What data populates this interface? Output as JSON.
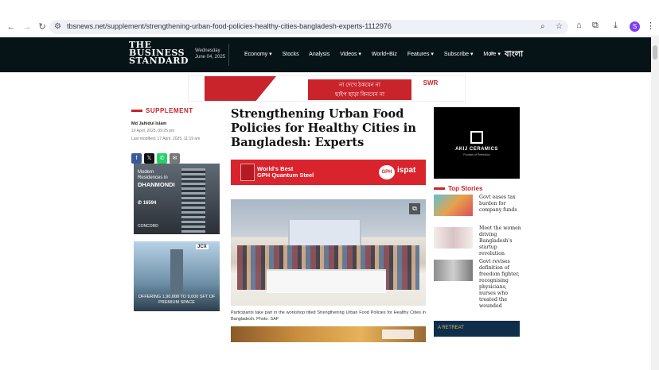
{
  "browser": {
    "url": "tbsnews.net/supplement/strengthening-urban-food-policies-healthy-cities-bangladesh-experts-1112976",
    "profile_initial": "S"
  },
  "site": {
    "logo_line1": "THE",
    "logo_line2": "BUSINESS",
    "logo_line3": "STANDARD",
    "date_day": "Wednesday",
    "date": "June 04, 2025",
    "menu": [
      "Economy ▾",
      "Stocks",
      "Analysis",
      "Videos ▾",
      "World+Biz",
      "Features ▾",
      "Subscribe ▾",
      "More ▾"
    ],
    "bangla": "বাংলা"
  },
  "banner_ad": {
    "line1": "না দেখে ঠকবেন না",
    "line2": "ছাইপ ছাড়া কিনবেন না",
    "brand": "SWR"
  },
  "article": {
    "section": "SUPPLEMENT",
    "author": "Md Jahidul Islam",
    "published": "10 April, 2025, 09:25 pm",
    "modified": "Last modified: 17 April, 2025, 11:19 am",
    "title": "Strengthening Urban Food Policies for Healthy Cities in Bangladesh: Experts",
    "caption": "Participants take part in the workshop titled Strengthening Urban Food Policies for Healthy Cities in Bangladesh. Photo: SAF"
  },
  "gph_ad": {
    "line1": "World's Best",
    "line2": "GPH Quantum Steel",
    "logo": "GPH",
    "brand": "ispat"
  },
  "left_ads": {
    "ad1_line1": "Modern",
    "ad1_line2": "Residences in",
    "ad1_place": "DHANMONDI",
    "ad1_phone": "16594",
    "ad1_brand": "CONCORD",
    "ad2_brand": "JCX",
    "ad2_caption": "OFFERING 1,90,000 TO 9,000 SFT OF PREMIUM SPACE"
  },
  "right_ad": {
    "name": "AKIJ CERAMICS",
    "sub": "Promise of Perfection"
  },
  "top_stories": {
    "heading": "Top Stories",
    "items": [
      {
        "text": "Govt eases tax burden for company funds"
      },
      {
        "text": "Meet the women driving Bangladesh's startup revolution"
      },
      {
        "text": "Govt revises definition of freedom fighter, recognising physicians, nurses who treated the wounded"
      }
    ],
    "ad_text": "A RETREAT"
  },
  "share_icons": [
    "f",
    "𝕏",
    "✆",
    "✉"
  ],
  "colors": {
    "header_bg": "#071417",
    "accent_red": "#c9232b",
    "facebook": "#3b5998",
    "x": "#111111",
    "whatsapp": "#25d366",
    "email": "#777777"
  }
}
